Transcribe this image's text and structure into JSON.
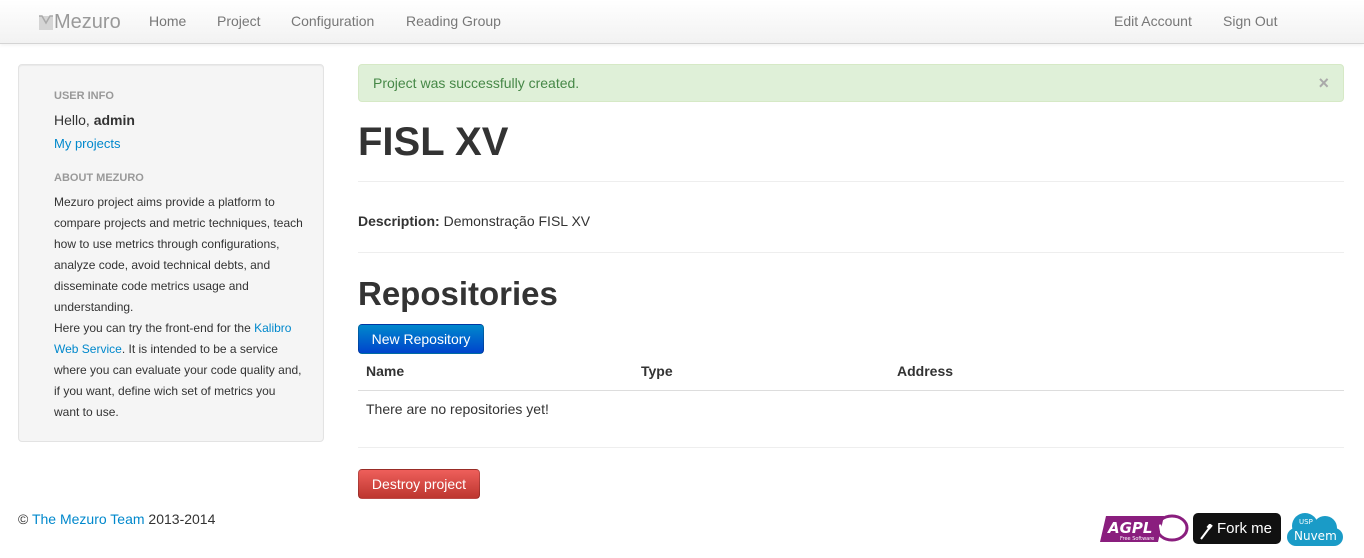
{
  "navbar": {
    "brand": "Mezuro",
    "links": [
      "Home",
      "Project",
      "Configuration",
      "Reading Group"
    ],
    "right_links": [
      "Edit Account",
      "Sign Out"
    ]
  },
  "sidebar": {
    "user_info_header": "USER INFO",
    "hello_prefix": "Hello, ",
    "username": "admin",
    "my_projects": "My projects",
    "about_header": "ABOUT MEZURO",
    "about_text_1": "Mezuro project aims provide a platform to compare projects and metric techniques, teach how to use metrics through configurations, analyze code, avoid technical debts, and disseminate code metrics usage and understanding.",
    "about_text_2": "Here you can try the front-end for the ",
    "about_link": "Kalibro Web Service",
    "about_text_3": ". It is intended to be a service where you can evaluate your code quality and, if you want, define wich set of metrics you want to use."
  },
  "alert": {
    "message": "Project was successfully created.",
    "close": "×"
  },
  "project": {
    "title": "FISL XV",
    "description_label": "Description:",
    "description": "Demonstração FISL XV"
  },
  "repositories": {
    "heading": "Repositories",
    "new_button": "New Repository",
    "columns": [
      "Name",
      "Type",
      "Address"
    ],
    "empty_message": "There are no repositories yet!"
  },
  "destroy_button": "Destroy project",
  "footer": {
    "copyright": "© ",
    "team_link": "The Mezuro Team",
    "years": " 2013-2014",
    "badges": {
      "agpl": "AGPL v3",
      "agpl_sub": "Free Software",
      "fork": "Fork me",
      "nuvem": "Nuvem"
    }
  },
  "colors": {
    "link": "#0088cc",
    "alert_bg": "#dff0d8",
    "alert_text": "#468847",
    "primary": "#0055cc",
    "danger": "#bd362f"
  }
}
